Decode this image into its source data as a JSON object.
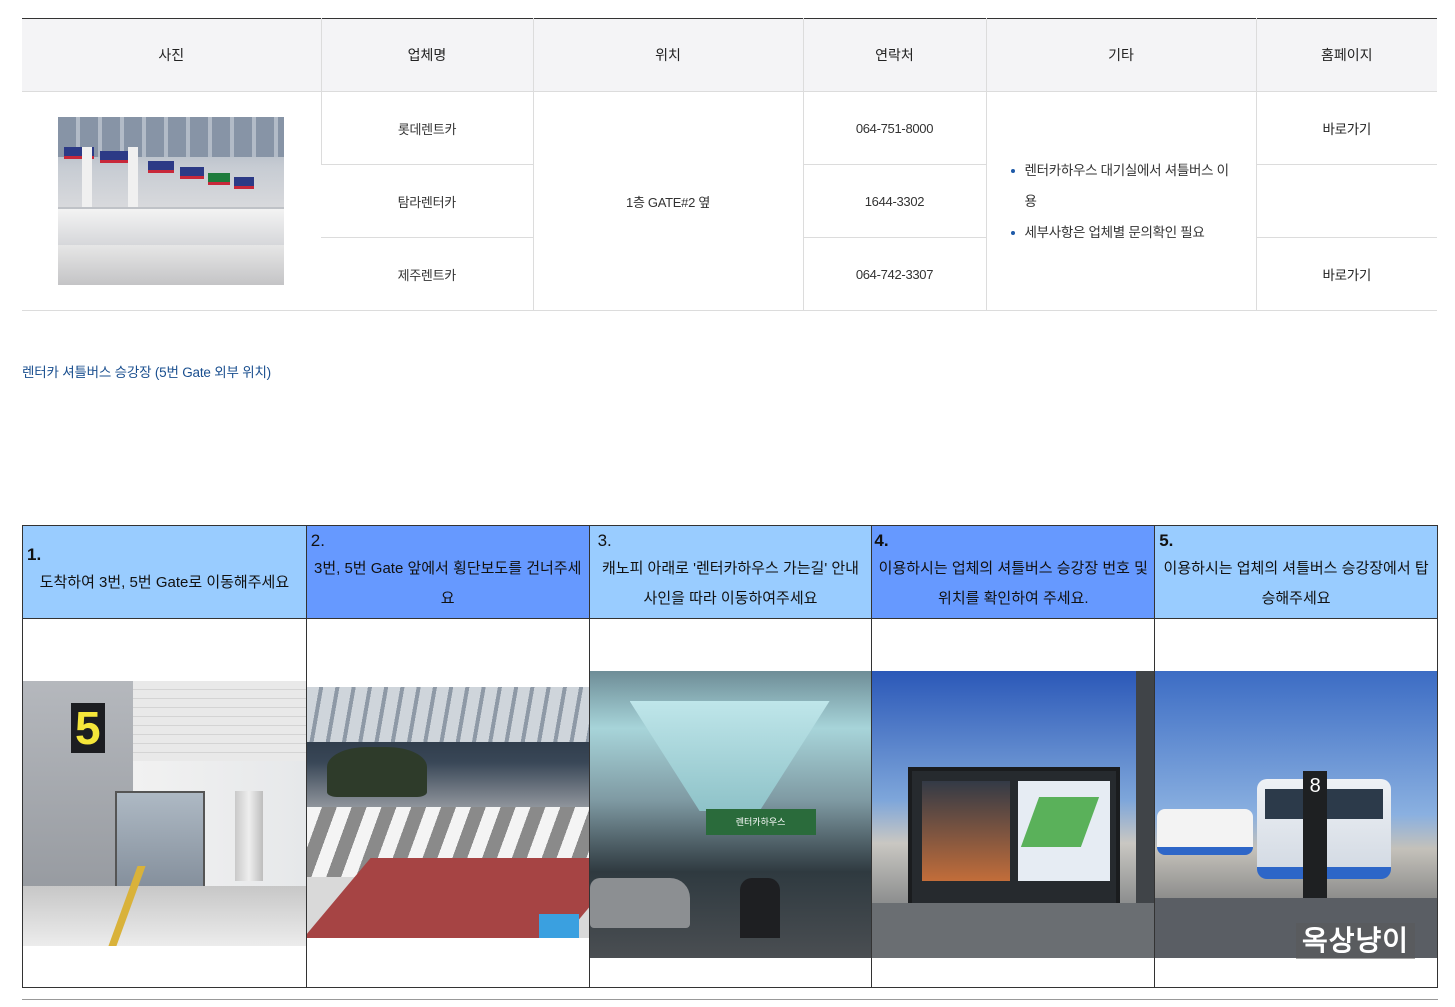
{
  "table": {
    "headers": [
      "사진",
      "업체명",
      "위치",
      "연락처",
      "기타",
      "홈페이지"
    ],
    "location": "1층 GATE#2 옆",
    "rows": [
      {
        "company": "롯데렌트카",
        "phone": "064-751-8000",
        "homepage": "바로가기"
      },
      {
        "company": "탐라렌터카",
        "phone": "1644-3302",
        "homepage": ""
      },
      {
        "company": "제주렌트카",
        "phone": "064-742-3307",
        "homepage": "바로가기"
      }
    ],
    "notes": [
      "렌터카하우스 대기실에서 셔틀버스 이용",
      "세부사항은 업체별 문의확인 필요"
    ]
  },
  "caption": "렌터카 셔틀버스 승강장 (5번 Gate 외부 위치)",
  "steps": [
    {
      "num": "1.",
      "text": "도착하여 3번, 5번 Gate로 이동해주세요",
      "color": "#99ccff"
    },
    {
      "num": "2.",
      "text": "3번, 5번 Gate 앞에서 횡단보도를 건너주세요",
      "color": "#6699ff"
    },
    {
      "num": "3.",
      "text": "캐노피 아래로 '렌터카하우스 가는길' 안내 사인을 따라 이동하여주세요",
      "color": "#99ccff"
    },
    {
      "num": "4.",
      "text": "이용하시는 업체의 셔틀버스 승강장 번호 및 위치를 확인하여 주세요.",
      "color": "#6699ff"
    },
    {
      "num": "5.",
      "text": "이용하시는 업체의 셔틀버스 승강장에서 탑승해주세요",
      "color": "#99ccff"
    }
  ],
  "photo_signs": {
    "gate_number": "5",
    "canopy_sign": "렌터카하우스",
    "stop_number": "8"
  },
  "watermark": "옥상냥이"
}
